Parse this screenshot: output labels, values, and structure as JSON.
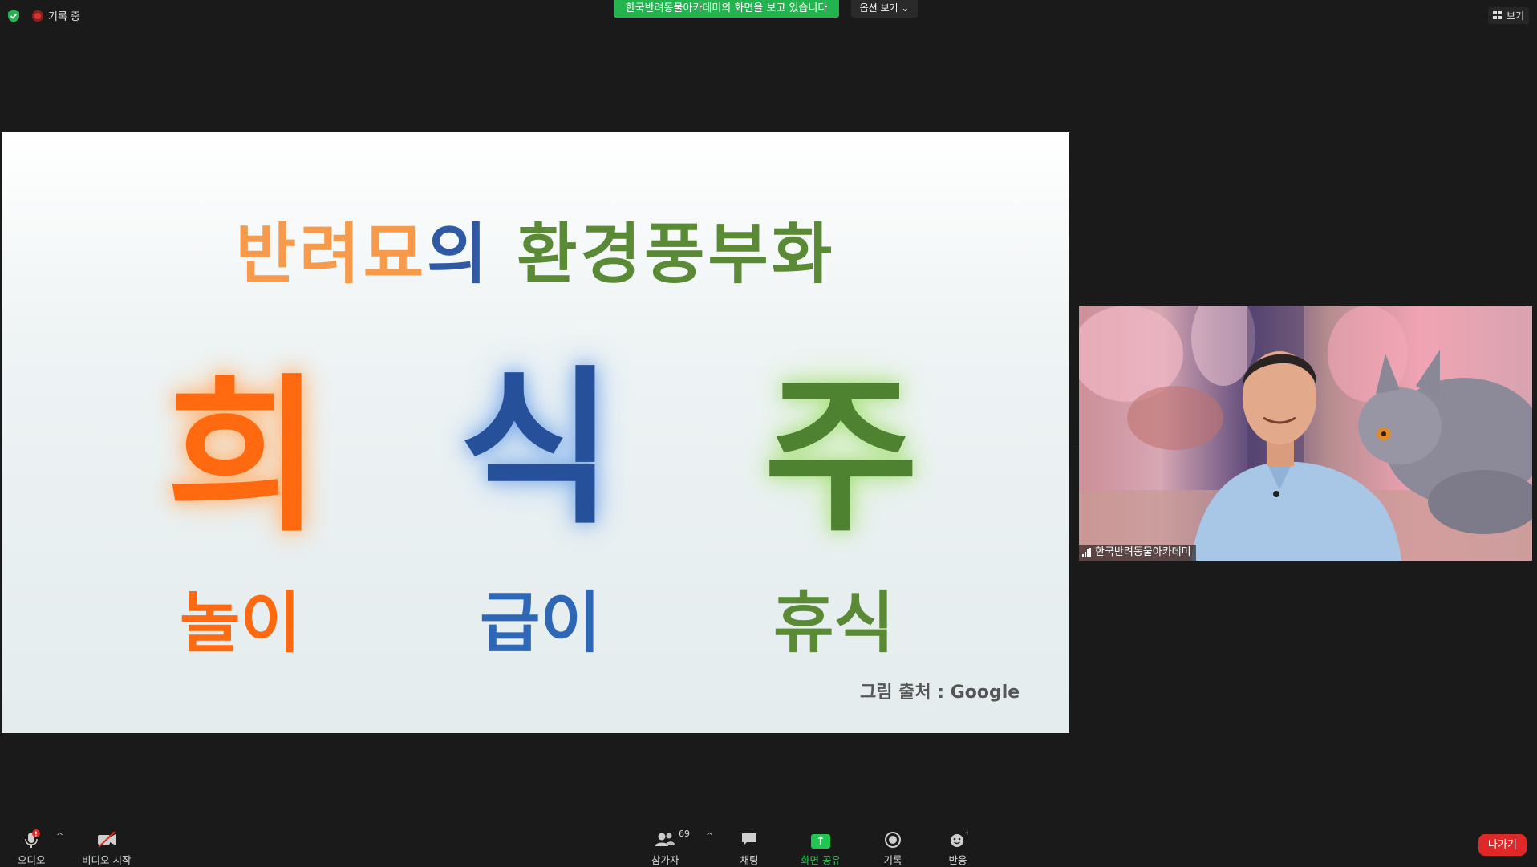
{
  "topbar": {
    "recording_label": "기록 중",
    "viewing_banner": "한국반려동물아카데미의 화면을 보고 있습니다",
    "view_options": "옵션 보기 ⌄",
    "view_button": "보기"
  },
  "slide": {
    "title_part1": "반려묘",
    "title_part2": "의",
    "title_part3": "환경풍부화",
    "big_char_1": "희",
    "big_char_2": "식",
    "big_char_3": "주",
    "word_1": "놀이",
    "word_2": "급이",
    "word_3": "휴식",
    "credit": "그림 출처 : Google"
  },
  "participant": {
    "name": "한국반려동물아카데미"
  },
  "toolbar": {
    "audio_label": "오디오",
    "video_label": "비디오 시작",
    "participants_label": "참가자",
    "participants_count": "69",
    "chat_label": "채팅",
    "share_label": "화면 공유",
    "record_label": "기록",
    "reactions_label": "반응",
    "leave_label": "나가기"
  },
  "colors": {
    "background": "#1a1a1a",
    "share_green": "#23c552",
    "leave_red": "#e02828",
    "banner_green": "#23b34f"
  }
}
